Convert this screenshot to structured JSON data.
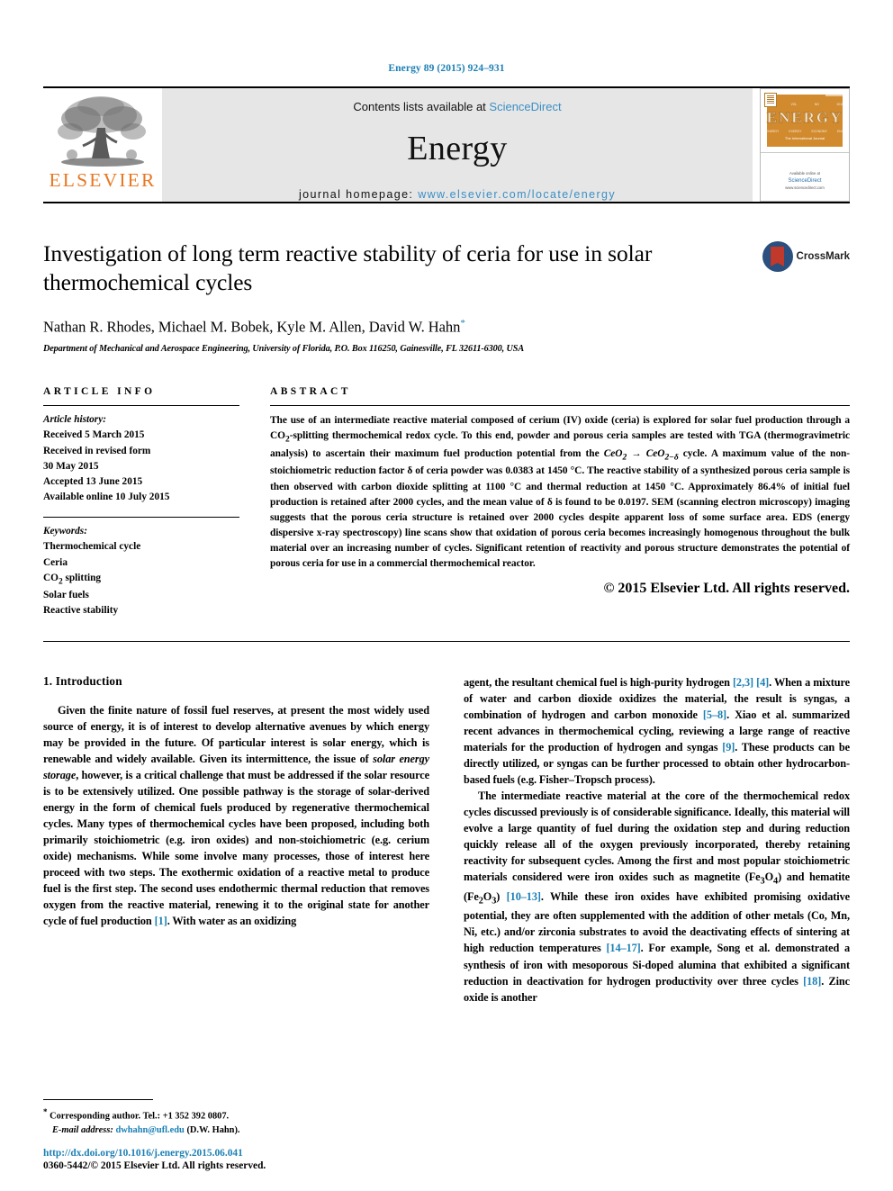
{
  "running_head": "Energy 89 (2015) 924–931",
  "masthead": {
    "contents_prefix": "Contents lists available at ",
    "sciencedirect": "ScienceDirect",
    "journal_name": "Energy",
    "homepage_prefix": "journal homepage: ",
    "homepage_url": "www.elsevier.com/locate/energy",
    "publisher": "ELSEVIER",
    "cover": {
      "title": "ENERGY",
      "subtitle": "The International Journal",
      "footer_line1": "Available online at",
      "footer_line2": "ScienceDirect",
      "footer_line3": "www.sciencedirect.com"
    }
  },
  "article": {
    "title": "Investigation of long term reactive stability of ceria for use in solar thermochemical cycles",
    "authors": "Nathan R. Rhodes, Michael M. Bobek, Kyle M. Allen, David W. Hahn",
    "affiliation": "Department of Mechanical and Aerospace Engineering, University of Florida, P.O. Box 116250, Gainesville, FL 32611-6300, USA",
    "crossmark_label": "CrossMark"
  },
  "article_info": {
    "heading": "ARTICLE INFO",
    "history_label": "Article history:",
    "history": [
      "Received 5 March 2015",
      "Received in revised form",
      "30 May 2015",
      "Accepted 13 June 2015",
      "Available online 10 July 2015"
    ],
    "keywords_label": "Keywords:",
    "keywords": [
      "Thermochemical cycle",
      "Ceria",
      "CO2 splitting",
      "Solar fuels",
      "Reactive stability"
    ]
  },
  "abstract": {
    "heading": "ABSTRACT",
    "text": "The use of an intermediate reactive material composed of cerium (IV) oxide (ceria) is explored for solar fuel production through a CO2-splitting thermochemical redox cycle. To this end, powder and porous ceria samples are tested with TGA (thermogravimetric analysis) to ascertain their maximum fuel production potential from the CeO2 → CeO2−δ cycle. A maximum value of the non-stoichiometric reduction factor δ of ceria powder was 0.0383 at 1450 °C. The reactive stability of a synthesized porous ceria sample is then observed with carbon dioxide splitting at 1100 °C and thermal reduction at 1450 °C. Approximately 86.4% of initial fuel production is retained after 2000 cycles, and the mean value of δ is found to be 0.0197. SEM (scanning electron microscopy) imaging suggests that the porous ceria structure is retained over 2000 cycles despite apparent loss of some surface area. EDS (energy dispersive x-ray spectroscopy) line scans show that oxidation of porous ceria becomes increasingly homogenous throughout the bulk material over an increasing number of cycles. Significant retention of reactivity and porous structure demonstrates the potential of porous ceria for use in a commercial thermochemical reactor.",
    "copyright": "© 2015 Elsevier Ltd. All rights reserved."
  },
  "sections": {
    "introduction_heading": "1. Introduction",
    "left_para_1": "Given the finite nature of fossil fuel reserves, at present the most widely used source of energy, it is of interest to develop alternative avenues by which energy may be provided in the future. Of particular interest is solar energy, which is renewable and widely available. Given its intermittence, the issue of solar energy storage, however, is a critical challenge that must be addressed if the solar resource is to be extensively utilized. One possible pathway is the storage of solar-derived energy in the form of chemical fuels produced by regenerative thermochemical cycles. Many types of thermochemical cycles have been proposed, including both primarily stoichiometric (e.g. iron oxides) and non-stoichiometric (e.g. cerium oxide) mechanisms. While some involve many processes, those of interest here proceed with two steps. The exothermic oxidation of a reactive metal to produce fuel is the first step. The second uses endothermic thermal reduction that removes oxygen from the reactive material, renewing it to the original state for another cycle of fuel production [1]. With water as an oxidizing",
    "right_para_1": "agent, the resultant chemical fuel is high-purity hydrogen [2,3] [4]. When a mixture of water and carbon dioxide oxidizes the material, the result is syngas, a combination of hydrogen and carbon monoxide [5–8]. Xiao et al. summarized recent advances in thermochemical cycling, reviewing a large range of reactive materials for the production of hydrogen and syngas [9]. These products can be directly utilized, or syngas can be further processed to obtain other hydrocarbon-based fuels (e.g. Fisher–Tropsch process).",
    "right_para_2": "The intermediate reactive material at the core of the thermochemical redox cycles discussed previously is of considerable significance. Ideally, this material will evolve a large quantity of fuel during the oxidation step and during reduction quickly release all of the oxygen previously incorporated, thereby retaining reactivity for subsequent cycles. Among the first and most popular stoichiometric materials considered were iron oxides such as magnetite (Fe3O4) and hematite (Fe2O3) [10–13]. While these iron oxides have exhibited promising oxidative potential, they are often supplemented with the addition of other metals (Co, Mn, Ni, etc.) and/or zirconia substrates to avoid the deactivating effects of sintering at high reduction temperatures [14–17]. For example, Song et al. demonstrated a synthesis of iron with mesoporous Si-doped alumina that exhibited a significant reduction in deactivation for hydrogen productivity over three cycles [18]. Zinc oxide is another"
  },
  "footnote": {
    "corresponding": "Corresponding author. Tel.: +1 352 392 0807.",
    "email_label": "E-mail address:",
    "email": "dwhahn@ufl.edu",
    "email_suffix": "(D.W. Hahn)."
  },
  "footer": {
    "doi": "http://dx.doi.org/10.1016/j.energy.2015.06.041",
    "issn": "0360-5442/© 2015 Elsevier Ltd. All rights reserved."
  },
  "colors": {
    "link": "#1b7fb5",
    "elsevier_orange": "#E87722",
    "masthead_grey": "#e6e6e6",
    "crossmark_blue": "#2b4f7e",
    "crossmark_red": "#c0392b"
  }
}
